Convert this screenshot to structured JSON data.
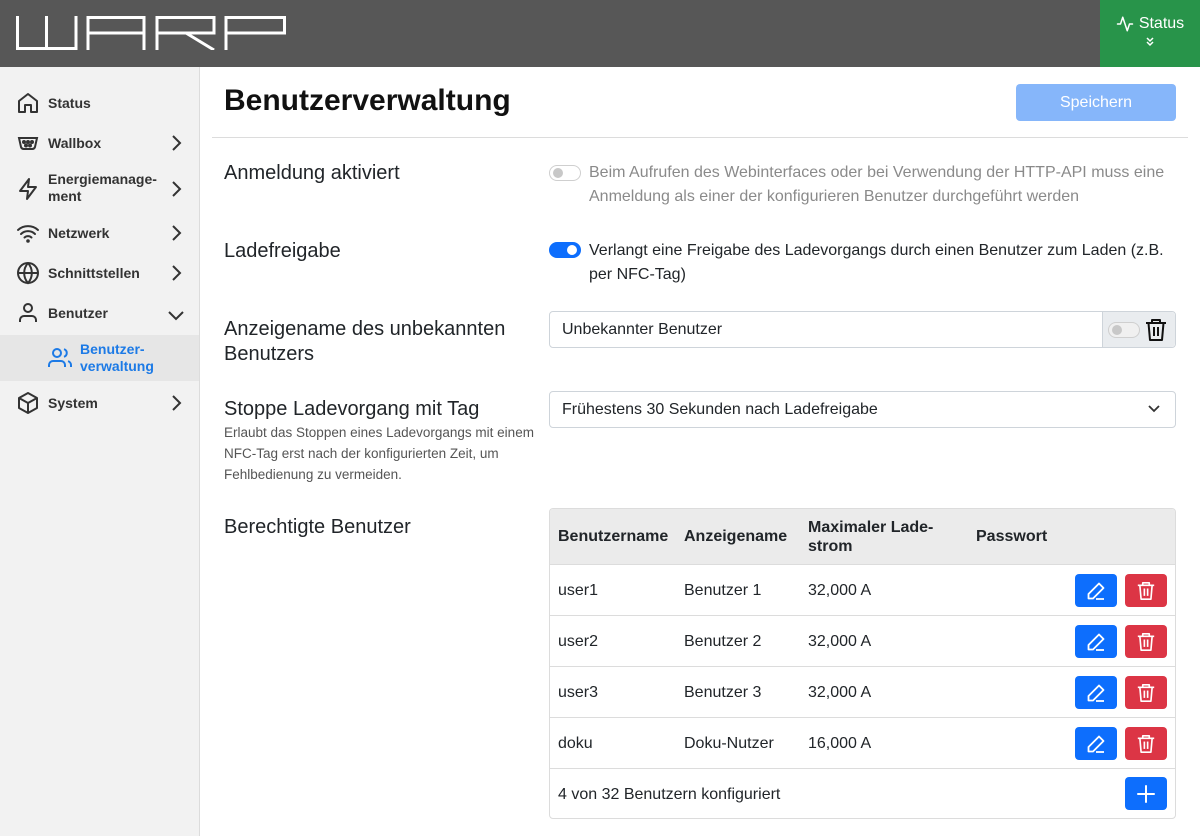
{
  "header": {
    "logo_text": "WARP",
    "status_button": "Status"
  },
  "sidebar": {
    "items": [
      {
        "label": "Status",
        "icon": "home-icon"
      },
      {
        "label": "Wallbox",
        "icon": "plug-icon"
      },
      {
        "label": "Energiemanage-\nment",
        "icon": "lightning-icon"
      },
      {
        "label": "Netzwerk",
        "icon": "wifi-icon"
      },
      {
        "label": "Schnittstellen",
        "icon": "globe-icon"
      },
      {
        "label": "Benutzer",
        "icon": "user-icon",
        "expanded": true
      },
      {
        "label": "Benutzer-\nverwaltung",
        "icon": "users-icon",
        "active": true
      },
      {
        "label": "System",
        "icon": "box-icon"
      }
    ]
  },
  "main": {
    "title": "Benutzerverwaltung",
    "save_label": "Speichern",
    "login": {
      "label": "Anmeldung aktiviert",
      "enabled": false,
      "description": "Beim Aufrufen des Webinterfaces oder bei Verwendung der HTTP-API muss eine Anmeldung als einer der konfigurieren Benutzer durchgeführt werden"
    },
    "charge_release": {
      "label": "Ladefreigabe",
      "enabled": true,
      "description": "Verlangt eine Freigabe des Ladevorgangs durch einen Benutzer zum Laden (z.B. per NFC-Tag)"
    },
    "unknown_user": {
      "label": "Anzeigename des unbekannten Benutzers",
      "value": "Unbekannter Benutzer"
    },
    "stop_by_tag": {
      "label": "Stoppe Ladevorgang mit Tag",
      "help": "Erlaubt das Stoppen eines Ladevorgangs mit einem NFC-Tag erst nach der konfigurierten Zeit, um Fehlbedienung zu vermeiden.",
      "selected": "Frühestens 30 Sekunden nach Ladefreigabe"
    },
    "users": {
      "label": "Berechtigte Benutzer",
      "columns": [
        "Benutzername",
        "Anzeigename",
        "Maximaler Lade-\nstrom",
        "Passwort"
      ],
      "rows": [
        {
          "username": "user1",
          "display_name": "Benutzer 1",
          "max_current": "32,000 A",
          "password": ""
        },
        {
          "username": "user2",
          "display_name": "Benutzer 2",
          "max_current": "32,000 A",
          "password": ""
        },
        {
          "username": "user3",
          "display_name": "Benutzer 3",
          "max_current": "32,000 A",
          "password": ""
        },
        {
          "username": "doku",
          "display_name": "Doku-Nutzer",
          "max_current": "16,000 A",
          "password": ""
        }
      ],
      "footer": "4 von 32 Benutzern konfiguriert"
    }
  },
  "colors": {
    "topbar": "#575757",
    "status_green": "#28944a",
    "primary": "#0d6efd",
    "danger": "#dc3545",
    "active_nav": "#1c7ae6"
  }
}
